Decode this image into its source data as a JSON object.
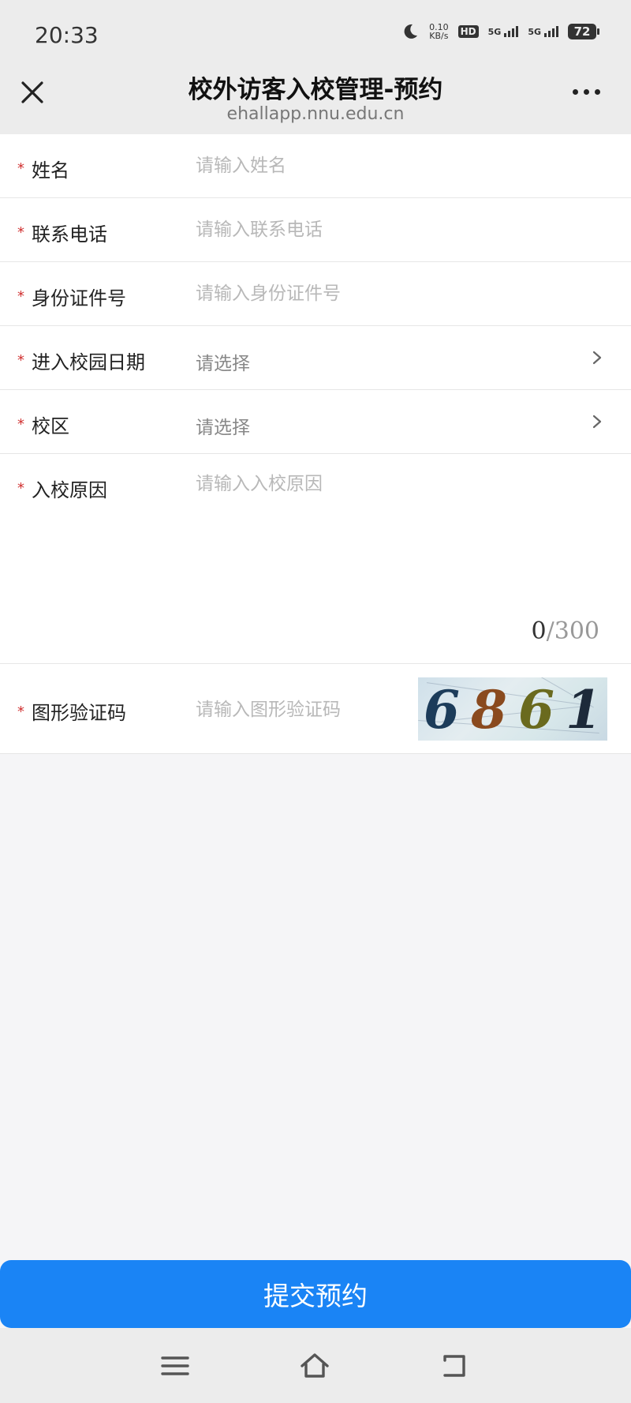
{
  "status_bar": {
    "time": "20:33",
    "net_speed_value": "0.10",
    "net_speed_unit": "KB/s",
    "hd": "HD",
    "signal1": "5G",
    "signal2": "5G",
    "battery": "72"
  },
  "nav": {
    "title": "校外访客入校管理-预约",
    "url": "ehallapp.nnu.edu.cn"
  },
  "form": {
    "required_mark": "*",
    "name": {
      "label": "姓名",
      "placeholder": "请输入姓名"
    },
    "phone": {
      "label": "联系电话",
      "placeholder": "请输入联系电话"
    },
    "id_number": {
      "label": "身份证件号",
      "placeholder": "请输入身份证件号"
    },
    "entry_date": {
      "label": "进入校园日期",
      "value": "请选择"
    },
    "campus": {
      "label": "校区",
      "value": "请选择"
    },
    "reason": {
      "label": "入校原因",
      "placeholder": "请输入入校原因",
      "count": "0",
      "max": "/300"
    },
    "captcha": {
      "label": "图形验证码",
      "placeholder": "请输入图形验证码",
      "digits": [
        "6",
        "8",
        "6",
        "1"
      ],
      "digit_colors": [
        "#1c3c5a",
        "#8a4a1e",
        "#6a6a1e",
        "#1d2a3a"
      ]
    }
  },
  "submit_label": "提交预约",
  "icons": {
    "close": "close-icon",
    "more": "more-icon",
    "chevron": "chevron-right-icon",
    "menu": "menu-icon",
    "home": "home-icon",
    "back": "back-icon"
  },
  "colors": {
    "primary": "#1a84f5",
    "required": "#d03030",
    "placeholder": "#b8b8b8"
  }
}
